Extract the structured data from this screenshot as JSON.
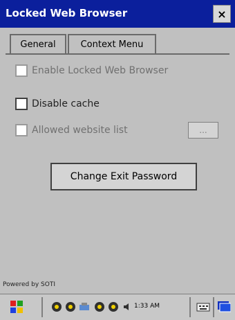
{
  "window": {
    "title": "Locked Web Browser",
    "close_label": "×"
  },
  "tabs": [
    {
      "label": "General",
      "active": true
    },
    {
      "label": "Context Menu",
      "active": false
    }
  ],
  "options": [
    {
      "label": "Enable Locked Web Browser",
      "checked": false,
      "enabled": false
    },
    {
      "label": "Disable cache",
      "checked": false,
      "enabled": true
    },
    {
      "label": "Allowed website list",
      "checked": false,
      "enabled": false
    }
  ],
  "browse_button": {
    "label": "..."
  },
  "change_password_button": {
    "label": "Change Exit Password"
  },
  "footer": {
    "powered_by": "Powered by SOTI"
  },
  "taskbar": {
    "time": "1:33 AM"
  }
}
